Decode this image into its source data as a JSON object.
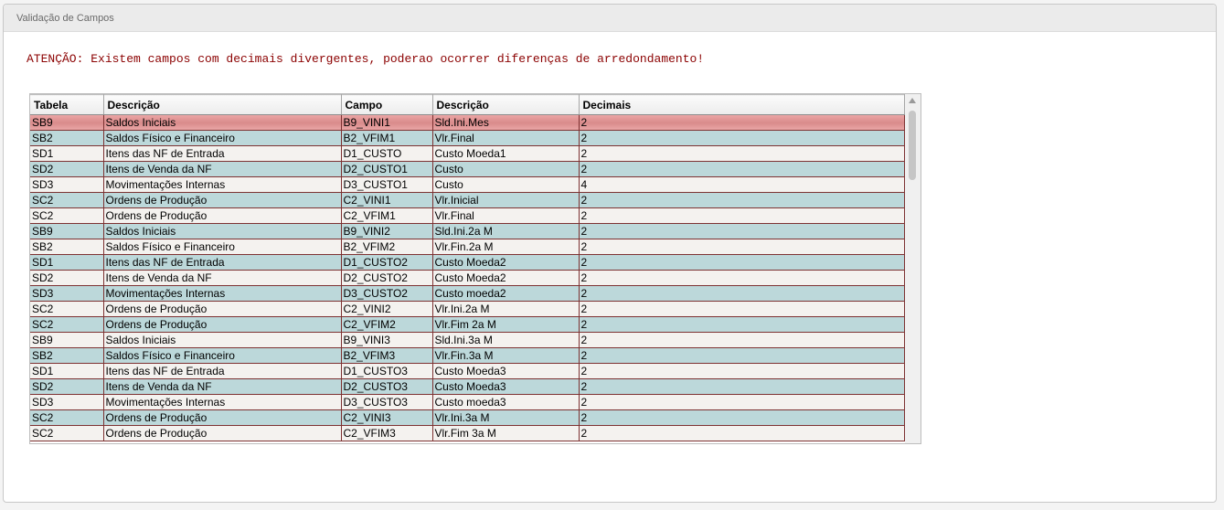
{
  "window": {
    "title": "Validação de Campos"
  },
  "warning": "ATENÇÃO: Existem campos com decimais divergentes, poderao ocorrer diferenças de arredondamento!",
  "table": {
    "columns": [
      "Tabela",
      "Descrição",
      "Campo",
      "Descrição",
      "Decimais"
    ],
    "rows": [
      [
        "SB9",
        "Saldos Iniciais",
        "B9_VINI1",
        "Sld.Ini.Mes",
        "2"
      ],
      [
        "SB2",
        "Saldos Físico e Financeiro",
        "B2_VFIM1",
        "Vlr.Final",
        "2"
      ],
      [
        "SD1",
        "Itens das NF de Entrada",
        "D1_CUSTO",
        "Custo Moeda1",
        "2"
      ],
      [
        "SD2",
        "Itens de Venda da NF",
        "D2_CUSTO1",
        "Custo",
        "2"
      ],
      [
        "SD3",
        "Movimentações Internas",
        "D3_CUSTO1",
        "Custo",
        "4"
      ],
      [
        "SC2",
        "Ordens de Produção",
        "C2_VINI1",
        "Vlr.Inicial",
        "2"
      ],
      [
        "SC2",
        "Ordens de Produção",
        "C2_VFIM1",
        "Vlr.Final",
        "2"
      ],
      [
        "SB9",
        "Saldos Iniciais",
        "B9_VINI2",
        "Sld.Ini.2a M",
        "2"
      ],
      [
        "SB2",
        "Saldos Físico e Financeiro",
        "B2_VFIM2",
        "Vlr.Fin.2a M",
        "2"
      ],
      [
        "SD1",
        "Itens das NF de Entrada",
        "D1_CUSTO2",
        "Custo Moeda2",
        "2"
      ],
      [
        "SD2",
        "Itens de Venda da NF",
        "D2_CUSTO2",
        "Custo Moeda2",
        "2"
      ],
      [
        "SD3",
        "Movimentações Internas",
        "D3_CUSTO2",
        "Custo moeda2",
        "2"
      ],
      [
        "SC2",
        "Ordens de Produção",
        "C2_VINI2",
        "Vlr.Ini.2a M",
        "2"
      ],
      [
        "SC2",
        "Ordens de Produção",
        "C2_VFIM2",
        "Vlr.Fim 2a M",
        "2"
      ],
      [
        "SB9",
        "Saldos Iniciais",
        "B9_VINI3",
        "Sld.Ini.3a M",
        "2"
      ],
      [
        "SB2",
        "Saldos Físico e Financeiro",
        "B2_VFIM3",
        "Vlr.Fin.3a M",
        "2"
      ],
      [
        "SD1",
        "Itens das NF de Entrada",
        "D1_CUSTO3",
        "Custo Moeda3",
        "2"
      ],
      [
        "SD2",
        "Itens de Venda da NF",
        "D2_CUSTO3",
        "Custo Moeda3",
        "2"
      ],
      [
        "SD3",
        "Movimentações Internas",
        "D3_CUSTO3",
        "Custo moeda3",
        "2"
      ],
      [
        "SC2",
        "Ordens de Produção",
        "C2_VINI3",
        "Vlr.Ini.3a M",
        "2"
      ],
      [
        "SC2",
        "Ordens de Produção",
        "C2_VFIM3",
        "Vlr.Fim 3a M",
        "2"
      ]
    ],
    "selected_row": 0
  },
  "colors": {
    "warning_text": "#8b0000",
    "row_odd": "#f4f2ef",
    "row_even": "#bcd8da",
    "row_selected": "#e29999"
  }
}
